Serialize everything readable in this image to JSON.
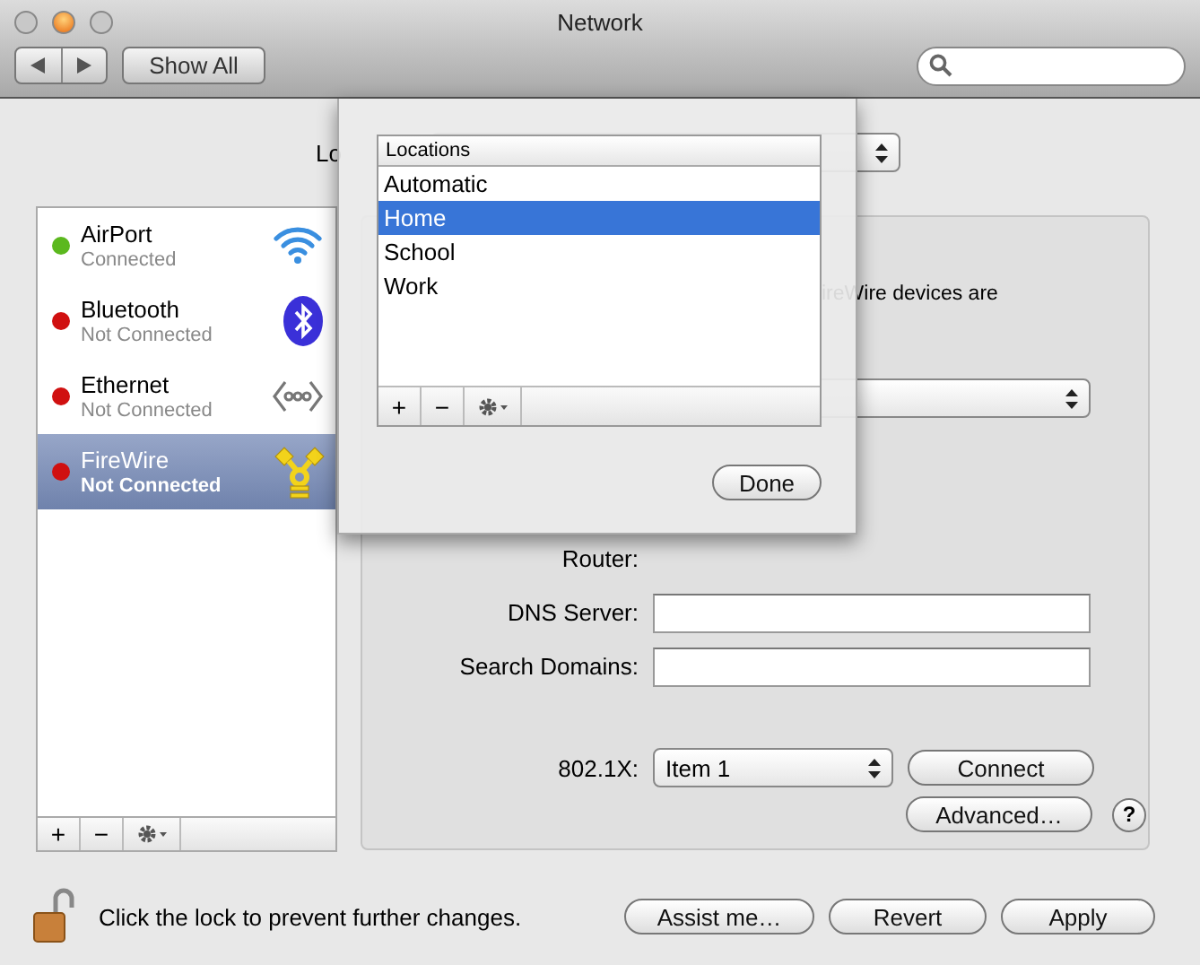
{
  "window": {
    "title": "Network"
  },
  "toolbar": {
    "show_all": "Show All"
  },
  "location": {
    "label_fragment": "Lo"
  },
  "services": [
    {
      "name": "AirPort",
      "status": "Connected",
      "color": "#5bb81e",
      "kind": "wifi",
      "selected": false
    },
    {
      "name": "Bluetooth",
      "status": "Not Connected",
      "color": "#d01010",
      "kind": "bluetooth",
      "selected": false
    },
    {
      "name": "Ethernet",
      "status": "Not Connected",
      "color": "#d01010",
      "kind": "ethernet",
      "selected": false
    },
    {
      "name": "FireWire",
      "status": "Not Connected",
      "color": "#d01010",
      "kind": "firewire",
      "selected": true
    }
  ],
  "service_toolbar": {
    "add": "+",
    "remove": "−"
  },
  "panel": {
    "description_fragment": "ireWire devices are",
    "fields": [
      {
        "kind": "select"
      },
      {
        "kind": "static"
      },
      {
        "kind": "static"
      },
      {
        "label": "Router:",
        "kind": "static"
      },
      {
        "label": "DNS Server:",
        "kind": "input"
      },
      {
        "label": "Search Domains:",
        "kind": "input"
      }
    ],
    "auth": {
      "label": "802.1X:",
      "value": "Item 1"
    },
    "connect": "Connect",
    "advanced": "Advanced…",
    "help": "?"
  },
  "footer": {
    "lock_text": "Click the lock to prevent further changes.",
    "buttons": [
      "Assist me…",
      "Revert",
      "Apply"
    ]
  },
  "sheet": {
    "header": "Locations",
    "locations": [
      {
        "name": "Automatic",
        "selected": false
      },
      {
        "name": "Home",
        "selected": true
      },
      {
        "name": "School",
        "selected": false
      },
      {
        "name": "Work",
        "selected": false
      }
    ],
    "add": "+",
    "remove": "−",
    "done": "Done"
  }
}
